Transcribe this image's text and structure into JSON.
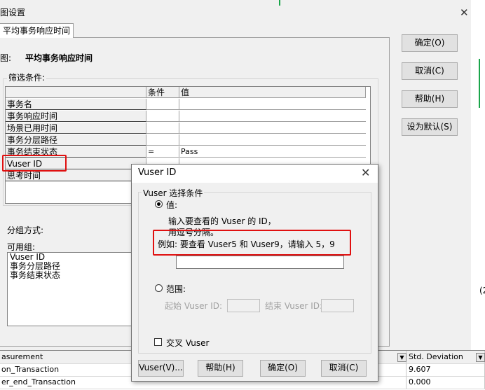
{
  "bg_dialog": {
    "title": "图设置",
    "close": "✕",
    "tab": "平均事务响应时间",
    "graph_label": "图:",
    "graph_name": "平均事务响应时间",
    "buttons": {
      "ok": "确定(O)",
      "cancel": "取消(C)",
      "help": "帮助(H)",
      "set_default": "设为默认(S)"
    },
    "filter": {
      "legend": "筛选条件:",
      "headers": {
        "condition": "条件",
        "value": "值"
      },
      "rows": [
        {
          "name": "事务名",
          "cond": "",
          "value": ""
        },
        {
          "name": "事务响应时间",
          "cond": "",
          "value": ""
        },
        {
          "name": "场景已用时间",
          "cond": "",
          "value": ""
        },
        {
          "name": "事务分层路径",
          "cond": "",
          "value": ""
        },
        {
          "name": "事务结束状态",
          "cond": "=",
          "value": "Pass"
        },
        {
          "name": "Vuser ID",
          "cond": "",
          "value": ""
        },
        {
          "name": "思考时间",
          "cond": "",
          "value": ""
        }
      ]
    },
    "group_by_label": "分组方式:",
    "available_groups_label": "可用组:",
    "available_groups": [
      "Vuser ID",
      "事务分层路径",
      "事务结束状态"
    ]
  },
  "right_panel": {
    "scale_label": "(2"
  },
  "bottom_table": {
    "headers": {
      "measurement": "asurement",
      "std_dev": "Std. Deviation"
    },
    "rows": [
      {
        "name": "on_Transaction",
        "std_dev": "9.607"
      },
      {
        "name": "er_end_Transaction",
        "std_dev": "0.000"
      }
    ]
  },
  "vuser_dialog": {
    "title": "Vuser ID",
    "close": "✕",
    "group_legend": "Vuser 选择条件",
    "value_radio_label": "值:",
    "hint_line1": "输入要查看的 Vuser 的 ID，",
    "hint_line2": "用逗号分隔。",
    "example": "例如: 要查看 Vuser5 和 Vuser9，请输入 5，9",
    "input_value": "",
    "range_radio_label": "范围:",
    "start_label": "起始 Vuser ID:",
    "end_label": "结束 Vuser ID:",
    "cross_vuser_label": "交叉 Vuser",
    "buttons": {
      "vuser": "Vuser(V)...",
      "help": "帮助(H)",
      "ok": "确定(O)",
      "cancel": "取消(C)"
    }
  },
  "colors": {
    "highlight_red": "#e01010",
    "accent_green": "#1aa54a",
    "focus_blue": "#0078d7"
  }
}
